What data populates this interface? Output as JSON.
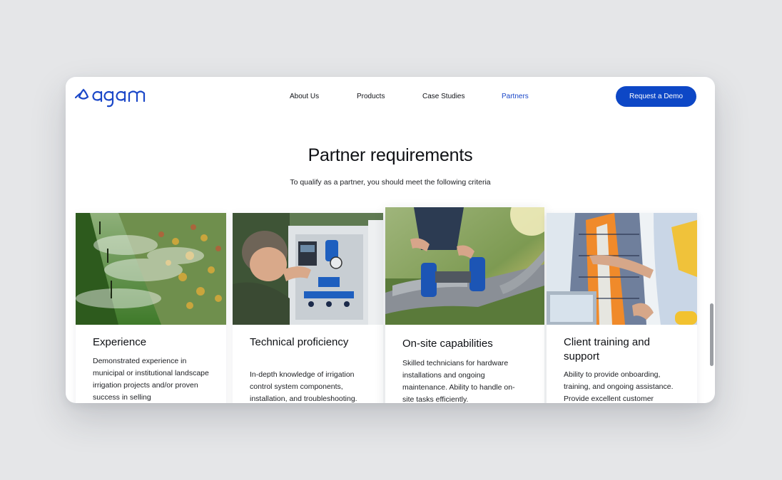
{
  "brand": {
    "name": "agam",
    "color": "#1a47c8"
  },
  "nav": {
    "items": [
      {
        "label": "About Us",
        "active": false
      },
      {
        "label": "Products",
        "active": false
      },
      {
        "label": "Case Studies",
        "active": false
      },
      {
        "label": "Partners",
        "active": true
      }
    ],
    "cta_label": "Request a Demo"
  },
  "section": {
    "title": "Partner requirements",
    "subtitle": "To qualify as a partner, you should meet the following criteria"
  },
  "cards": [
    {
      "title": "Experience",
      "body": "Demonstrated experience in municipal or institutional landscape irrigation projects and/or proven success in selling",
      "image": "sprinklers-photo"
    },
    {
      "title": "Technical proficiency",
      "body": "In-depth knowledge of irrigation control system components, installation, and troubleshooting.",
      "image": "technician-control-panel-photo"
    },
    {
      "title": "On-site capabilities",
      "body": "Skilled technicians for hardware installations and ongoing maintenance. Ability to handle on-site tasks efficiently.",
      "image": "pipe-valve-field-photo"
    },
    {
      "title": "Client training and support",
      "body": "Ability to provide onboarding, training, and ongoing assistance. Provide excellent customer",
      "image": "workers-laptop-photo"
    }
  ],
  "colors": {
    "accent": "#0d47c6",
    "background": "#e5e6e8"
  }
}
